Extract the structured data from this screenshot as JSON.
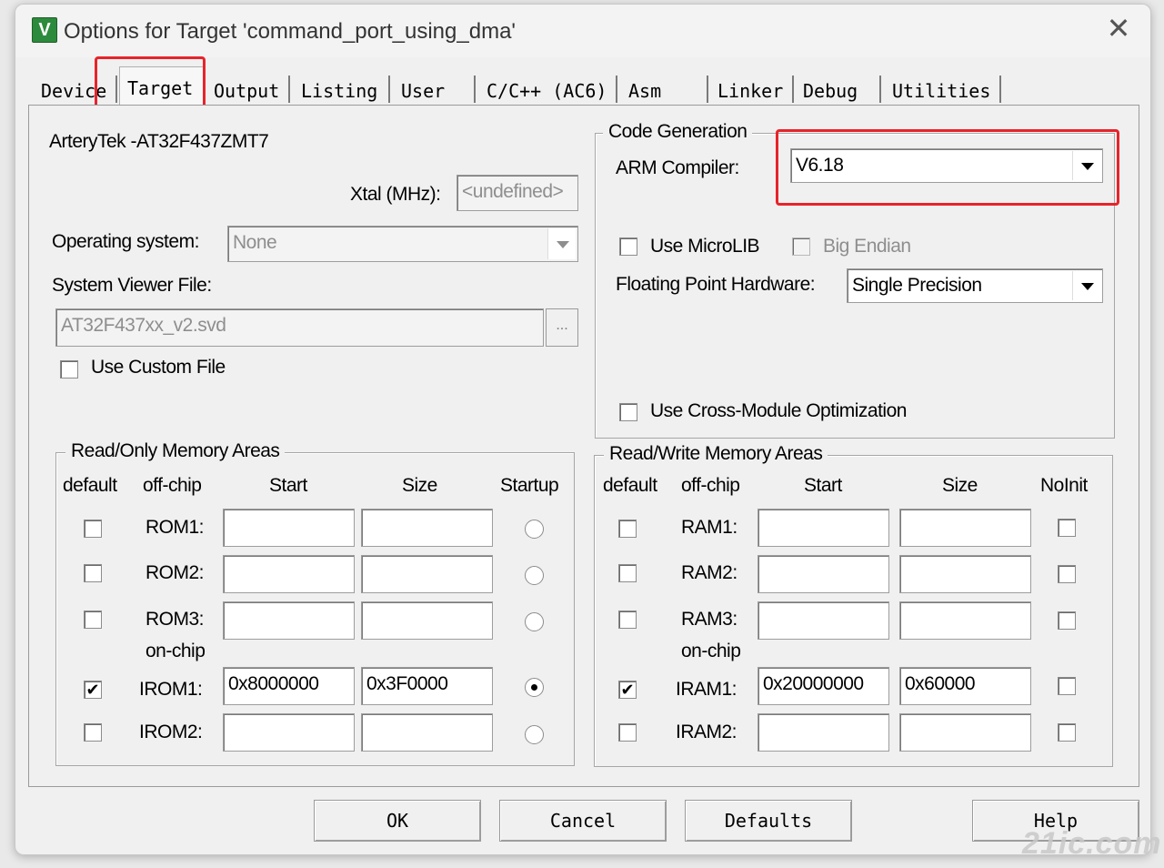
{
  "window": {
    "title": "Options for Target 'command_port_using_dma'",
    "icon_label": "V",
    "close_glyph": "✕"
  },
  "tabs": [
    "Device",
    "Target",
    "Output",
    "Listing",
    "User",
    "C/C++ (AC6)",
    "Asm",
    "Linker",
    "Debug",
    "Utilities"
  ],
  "active_tab": "Target",
  "device_name": "ArteryTek -AT32F437ZMT7",
  "xtal": {
    "label": "Xtal (MHz):",
    "value": "<undefined>"
  },
  "os": {
    "label": "Operating system:",
    "value": "None"
  },
  "svd": {
    "label": "System Viewer File:",
    "value": "AT32F437xx_v2.svd",
    "browse": "...",
    "custom_label": "Use Custom File",
    "custom_checked": false
  },
  "code_generation": {
    "title": "Code Generation",
    "compiler_label": "ARM Compiler:",
    "compiler_value": "V6.18",
    "microlib_label": "Use MicroLIB",
    "microlib_checked": false,
    "big_endian_label": "Big Endian",
    "big_endian_checked": false,
    "fpu_label": "Floating Point Hardware:",
    "fpu_value": "Single Precision",
    "cross_module_label": "Use Cross-Module Optimization",
    "cross_module_checked": false
  },
  "rom": {
    "title": "Read/Only Memory Areas",
    "headers": {
      "default": "default",
      "offchip": "off-chip",
      "start": "Start",
      "size": "Size",
      "startup": "Startup"
    },
    "onchip_label": "on-chip",
    "rows": [
      {
        "name": "ROM1:",
        "default": false,
        "start": "",
        "size": "",
        "startup": false
      },
      {
        "name": "ROM2:",
        "default": false,
        "start": "",
        "size": "",
        "startup": false
      },
      {
        "name": "ROM3:",
        "default": false,
        "start": "",
        "size": "",
        "startup": false
      },
      {
        "name": "IROM1:",
        "default": true,
        "start": "0x8000000",
        "size": "0x3F0000",
        "startup": true
      },
      {
        "name": "IROM2:",
        "default": false,
        "start": "",
        "size": "",
        "startup": false
      }
    ]
  },
  "ram": {
    "title": "Read/Write Memory Areas",
    "headers": {
      "default": "default",
      "offchip": "off-chip",
      "start": "Start",
      "size": "Size",
      "noinit": "NoInit"
    },
    "onchip_label": "on-chip",
    "rows": [
      {
        "name": "RAM1:",
        "default": false,
        "start": "",
        "size": "",
        "noinit": false
      },
      {
        "name": "RAM2:",
        "default": false,
        "start": "",
        "size": "",
        "noinit": false
      },
      {
        "name": "RAM3:",
        "default": false,
        "start": "",
        "size": "",
        "noinit": false
      },
      {
        "name": "IRAM1:",
        "default": true,
        "start": "0x20000000",
        "size": "0x60000",
        "noinit": false
      },
      {
        "name": "IRAM2:",
        "default": false,
        "start": "",
        "size": "",
        "noinit": false
      }
    ]
  },
  "buttons": {
    "ok": "OK",
    "cancel": "Cancel",
    "defaults": "Defaults",
    "help": "Help"
  },
  "watermark": "21ic.com",
  "colors": {
    "highlight": "#e8232a",
    "app_icon": "#2c8a3c"
  }
}
